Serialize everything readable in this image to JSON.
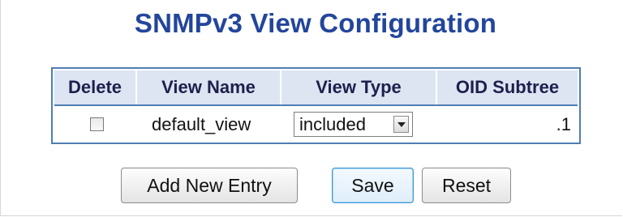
{
  "title": "SNMPv3 View Configuration",
  "table": {
    "headers": {
      "delete": "Delete",
      "view_name": "View Name",
      "view_type": "View Type",
      "oid_subtree": "OID Subtree"
    },
    "rows": [
      {
        "delete_checked": false,
        "view_name": "default_view",
        "view_type": "included",
        "oid_subtree": ".1"
      }
    ]
  },
  "buttons": {
    "add_new_entry": "Add New Entry",
    "save": "Save",
    "reset": "Reset"
  },
  "colors": {
    "title": "#23469b",
    "table_border": "#4f7eb3",
    "header_bg": "#dde5f2"
  },
  "icons": {
    "select_arrow": "chevron-down-icon"
  }
}
